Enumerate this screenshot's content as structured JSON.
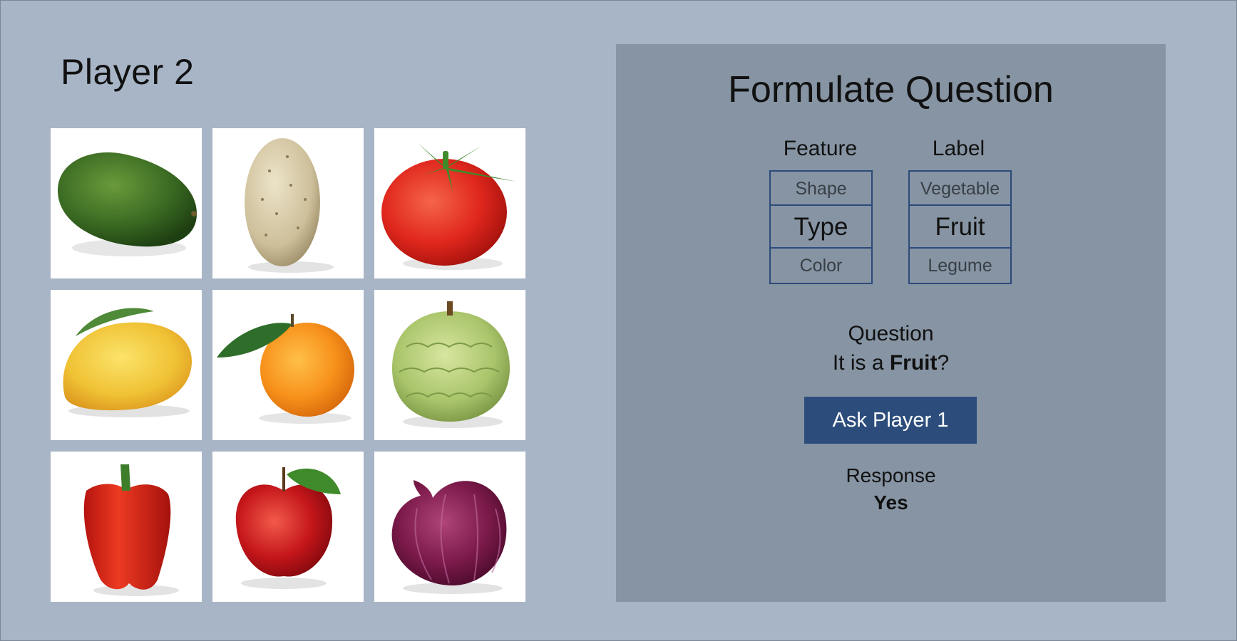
{
  "player": {
    "title": "Player 2"
  },
  "cards": [
    {
      "item": "avocado-image"
    },
    {
      "item": "potato-image"
    },
    {
      "item": "tomato-image"
    },
    {
      "item": "mango-image"
    },
    {
      "item": "orange-image"
    },
    {
      "item": "custard-apple-image"
    },
    {
      "item": "red-bell-pepper-image"
    },
    {
      "item": "red-apple-image"
    },
    {
      "item": "red-onion-image"
    }
  ],
  "panel": {
    "title": "Formulate Question",
    "feature": {
      "header": "Feature",
      "options": [
        "Shape",
        "Type",
        "Color"
      ],
      "selected": "Type"
    },
    "label": {
      "header": "Label",
      "options": [
        "Vegetable",
        "Fruit",
        "Legume"
      ],
      "selected": "Fruit"
    },
    "question": {
      "label": "Question",
      "prefix": "It is a ",
      "value": "Fruit",
      "suffix": "?"
    },
    "ask_button": "Ask Player 1",
    "response": {
      "label": "Response",
      "value": "Yes"
    }
  },
  "colors": {
    "background": "#a8b5c7",
    "panel": "#8694a3",
    "accent": "#2c4d7c"
  }
}
